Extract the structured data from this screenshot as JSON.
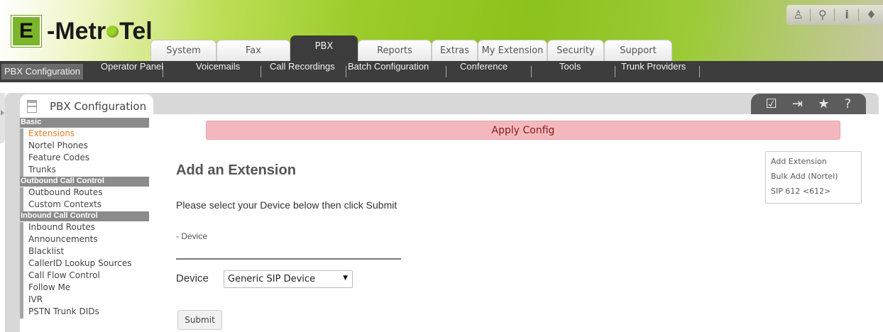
{
  "logo": {
    "letter": "E",
    "text_a": "-Metr",
    "text_b": "Tel"
  },
  "top_icons": [
    "user-icon",
    "search-icon",
    "info-icon",
    "theme-drop-icon"
  ],
  "top_icon_glyphs": [
    "♙",
    "⚲",
    "i",
    "♦"
  ],
  "main_tabs": [
    {
      "label": "System"
    },
    {
      "label": "Fax"
    },
    {
      "label": "PBX",
      "active": true
    },
    {
      "label": "Reports"
    },
    {
      "label": "Extras"
    },
    {
      "label": "My Extension"
    },
    {
      "label": "Security"
    },
    {
      "label": "Support"
    }
  ],
  "sub_nav": [
    {
      "label": "PBX Configuration",
      "active": true
    },
    {
      "label": "Operator Panel"
    },
    {
      "label": "Voicemails"
    },
    {
      "label": "Call Recordings"
    },
    {
      "label": "Batch Configuration"
    },
    {
      "label": "Conference"
    },
    {
      "label": "Tools"
    },
    {
      "label": "Trunk Providers"
    }
  ],
  "module": {
    "title": "PBX Configuration"
  },
  "tool_icons": [
    "edit-icon",
    "logout-icon",
    "star-icon",
    "help-icon"
  ],
  "tool_glyphs": [
    "☑",
    "⇥",
    "★",
    "?"
  ],
  "sidebar": {
    "groups": [
      {
        "header": "Basic",
        "items": [
          "Extensions",
          "Nortel Phones",
          "Feature Codes",
          "Trunks"
        ]
      },
      {
        "header": "Outbound Call Control",
        "items": [
          "Outbound Routes",
          "Custom Contexts"
        ]
      },
      {
        "header": "Inbound Call Control",
        "items": [
          "Inbound Routes",
          "Announcements",
          "Blacklist",
          "CallerID Lookup Sources",
          "Call Flow Control",
          "Follow Me",
          "IVR",
          "PSTN Trunk DIDs"
        ]
      }
    ],
    "active_item": "Extensions"
  },
  "apply_config": "Apply Config",
  "page_title": "Add an Extension",
  "instructions": "Please select your Device below then click Submit",
  "section_label": "- Device",
  "device": {
    "label": "Device",
    "selected": "Generic SIP Device"
  },
  "submit_label": "Submit",
  "right_links": [
    "Add Extension",
    "Bulk Add (Nortel)",
    "SIP 612 <612>"
  ],
  "colors": {
    "accent_green": "#8cc21c",
    "nav_dark": "#3d3d3d",
    "apply_bg": "#f2b8bd",
    "active_orange": "#f07b21"
  }
}
